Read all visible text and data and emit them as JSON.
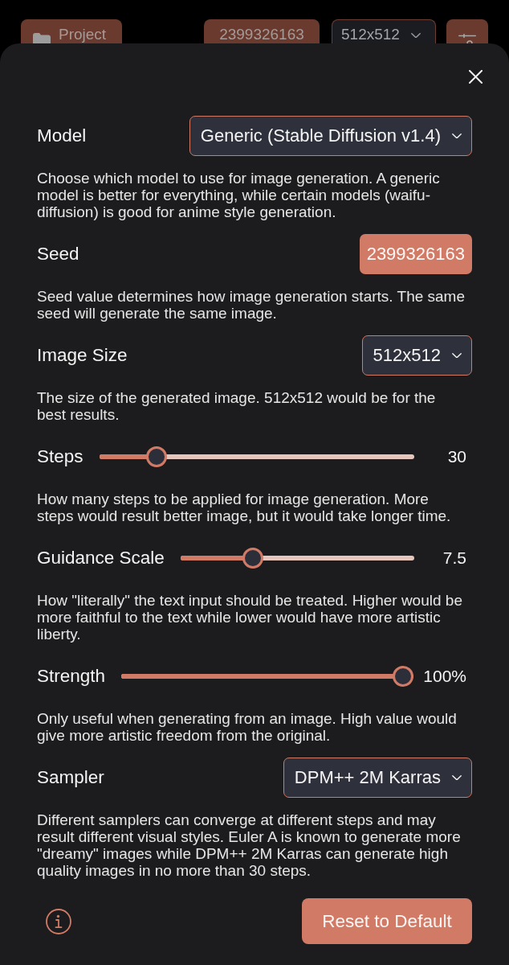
{
  "top_bar": {
    "project_button": "Project",
    "seed_button": "2399326163",
    "size_select": "512x512"
  },
  "settings_sheet": {
    "settings": [
      {
        "kind": "select",
        "label": "Model",
        "value": "Generic (Stable Diffusion v1.4)",
        "description": "Choose which model to use for image generation. A generic model is better for everything, while certain models (waifu-diffusion) is good for anime style generation."
      },
      {
        "kind": "button",
        "label": "Seed",
        "value": "2399326163",
        "description": "Seed value determines how image generation starts. The same seed will generate the same image."
      },
      {
        "kind": "select",
        "label": "Image Size",
        "value": "512x512",
        "description": "The size of the generated image. 512x512 would be for the best results."
      },
      {
        "kind": "slider",
        "label": "Steps",
        "level": 0.16,
        "reading": "30",
        "description": "How many steps to be applied for image generation. More steps would result better image, but it would take longer time."
      },
      {
        "kind": "slider",
        "label": "Guidance Scale",
        "level": 0.29,
        "reading": "7.5",
        "description": "How \"literally\" the text input should be treated. Higher would be more faithful to the text while lower would have more artistic liberty."
      },
      {
        "kind": "slider",
        "label": "Strength",
        "level": 1,
        "reading": "100%",
        "description": "Only useful when generating from an image. High value would give more artistic freedom from the original."
      },
      {
        "kind": "select",
        "label": "Sampler",
        "value": "DPM++ 2M Karras",
        "description": "Different samplers can converge at different steps and may result different visual styles. Euler A is known to generate more \"dreamy\" images while DPM++ 2M Karras can generate high quality images in no more than 30 steps."
      }
    ],
    "reset_button": "Reset to Default"
  }
}
